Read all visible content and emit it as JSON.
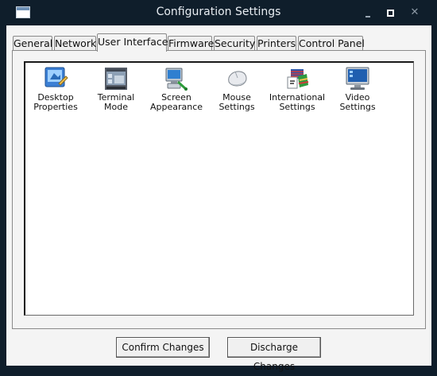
{
  "window": {
    "title": "Configuration Settings"
  },
  "tabs": [
    {
      "label": "General"
    },
    {
      "label": "Network"
    },
    {
      "label": "User Interface",
      "active": true
    },
    {
      "label": "Firmware"
    },
    {
      "label": "Security"
    },
    {
      "label": "Printers"
    },
    {
      "label": "Control Panel"
    }
  ],
  "items": [
    {
      "label": "Desktop Properties",
      "icon": "desktop-properties-icon"
    },
    {
      "label": "Terminal Mode",
      "icon": "terminal-mode-icon"
    },
    {
      "label": "Screen Appearance",
      "icon": "screen-appearance-icon"
    },
    {
      "label": "Mouse Settings",
      "icon": "mouse-icon"
    },
    {
      "label": "International Settings",
      "icon": "international-icon"
    },
    {
      "label": "Video Settings",
      "icon": "monitor-icon"
    }
  ],
  "buttons": {
    "confirm": "Confirm Changes",
    "discharge": "Discharge Changes"
  }
}
